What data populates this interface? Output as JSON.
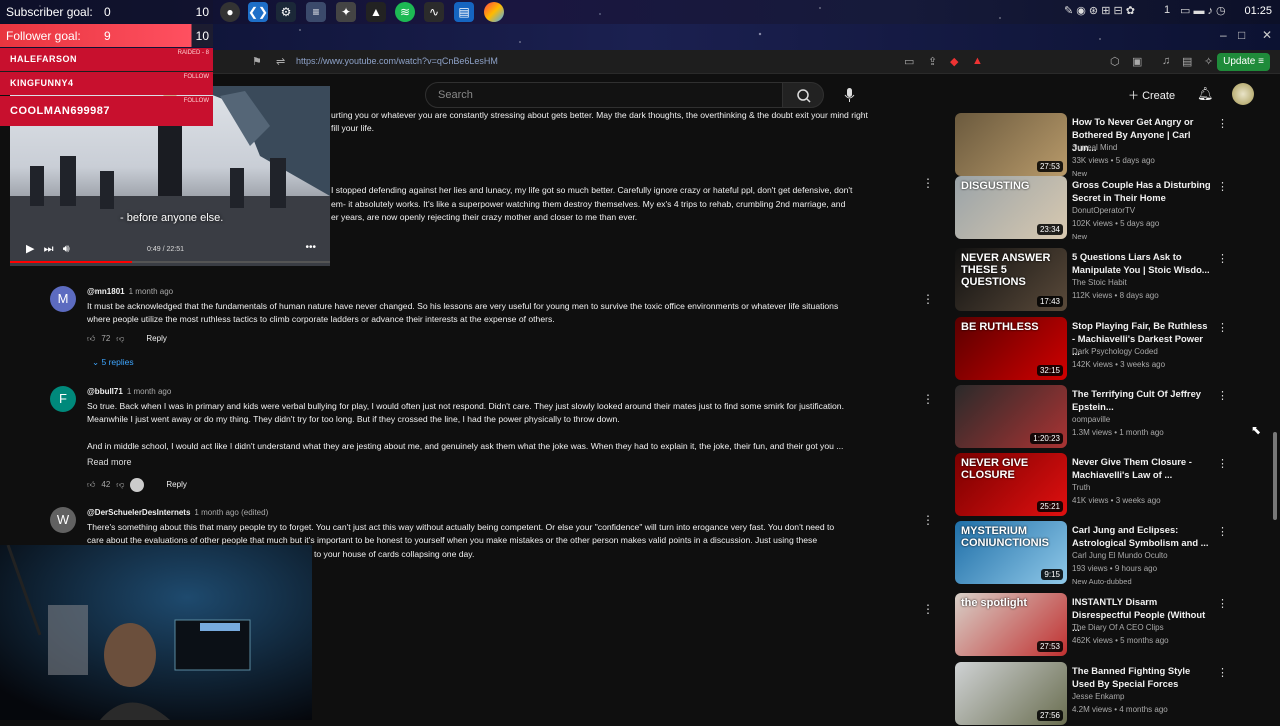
{
  "taskbar": {
    "clock": "01:25",
    "tray_number": "1"
  },
  "stream": {
    "subscriber_goal": {
      "label": "Subscriber goal:",
      "current": "0",
      "target": "10"
    },
    "follower_goal": {
      "label": "Follower goal:",
      "current": "9",
      "target": "10"
    },
    "alerts": [
      {
        "name": "HALEFARSON",
        "tag": "RAIDED - 8"
      },
      {
        "name": "KINGFUNNY4",
        "tag": "FOLLOW"
      },
      {
        "name": "COOLMAN699987",
        "tag": "FOLLOW"
      }
    ],
    "video": {
      "caption": "- before anyone else.",
      "time": "0:49 / 22:51",
      "progress": 0.04
    }
  },
  "browser": {
    "url": "https://www.youtube.com/watch?v=qCnBe6LesHM",
    "update_label": "Update"
  },
  "masthead": {
    "search_placeholder": "Search",
    "create_label": "Create"
  },
  "comments": {
    "partial1": "urting you or whatever you are constantly stressing about gets better. May the dark thoughts, the overthinking & the doubt exit your mind right",
    "partial1b": "fill your life.",
    "partial2a": "I stopped defending against her lies and lunacy, my life got so much better.  Carefully ignore crazy or hateful ppl, don't get defensive, don't",
    "partial2b": "em- it absolutely works.  It's like a superpower watching them destroy themselves. My ex's 4 trips to rehab, crumbling 2nd marriage, and",
    "partial2c": "er years, are now openly rejecting their crazy mother and closer to me than ever.",
    "items": [
      {
        "avatar": "M",
        "handle": "@mn1801",
        "time": "1 month ago",
        "lines": [
          "It must be acknowledged that the fundamentals of human nature have never changed. So his lessons are very useful for young men to survive the toxic office environments or whatever life situations",
          "where people utilize the most ruthless tactics to climb corporate ladders or advance their interests at the expense of others."
        ],
        "likes": "72",
        "reply": "Reply",
        "replies": "5 replies"
      },
      {
        "avatar": "F",
        "handle": "@bbull71",
        "time": "1 month ago",
        "lines": [
          "So true. Back when I was in primary and kids were verbal bullying for play, I would often just not respond. Didn't care. They just slowly looked around their mates just to find some smirk for justification.",
          "Meanwhile I just went away or do my thing. They didn't try for too long. But if they crossed the line, I had the power physically to throw down.",
          "",
          "And in middle school, I would act like I didn't understand what they are jesting about me, and genuinely ask them what the joke was. When they had to explain it, the joke, their fun, and their got you ..."
        ],
        "read_more": "Read more",
        "likes": "42",
        "reply": "Reply"
      },
      {
        "avatar": "W",
        "handle": "@DerSchuelerDesInternets",
        "time": "1 month ago (edited)",
        "lines": [
          "There's something about this that many people try to forget. You can't just act this way without actually being competent. Or else your \"confidence\" will turn into erogance very fast. You don't need to",
          "care about the evaluations of other people that much but it's important to be honest to yourself when you make mistakes or the other person makes valid points in a discussion. Just using these",
          "to your house of cards collapsing one day."
        ]
      }
    ]
  },
  "sidebar": [
    {
      "title": "How To Never Get Angry or Bothered By Anyone | Carl Jun...",
      "channel": "Surreal Mind",
      "meta": "33K views • 5 days ago",
      "badge": "New",
      "duration": "27:53",
      "thumb_text": "",
      "colors": [
        "#6b5a3e",
        "#b89a6a"
      ]
    },
    {
      "title": "Gross Couple Has a Disturbing Secret in Their Home",
      "channel": "DonutOperatorTV",
      "meta": "102K views • 5 days ago",
      "badge": "New",
      "duration": "23:34",
      "thumb_text": "DISGUSTING",
      "colors": [
        "#9aa3a8",
        "#d8c9b0"
      ]
    },
    {
      "title": "5 Questions Liars Ask to Manipulate You | Stoic Wisdo...",
      "channel": "The Stoic Habit",
      "meta": "112K views • 8 days ago",
      "badge": "",
      "duration": "17:43",
      "thumb_text": "NEVER ANSWER THESE 5 QUESTIONS",
      "colors": [
        "#111",
        "#5a4a3a"
      ]
    },
    {
      "title": "Stop Playing Fair, Be Ruthless - Machiavelli's Darkest Power ...",
      "channel": "Dark Psychology Coded",
      "meta": "142K views • 3 weeks ago",
      "badge": "",
      "duration": "32:15",
      "thumb_text": "BE RUTHLESS",
      "colors": [
        "#5a0000",
        "#d00000"
      ]
    },
    {
      "title": "The Terrifying Cult Of Jeffrey Epstein...",
      "channel": "oompaville",
      "meta": "1.3M views • 1 month ago",
      "badge": "",
      "duration": "1:20:23",
      "thumb_text": "",
      "colors": [
        "#2a2a2a",
        "#aa3333"
      ]
    },
    {
      "title": "Never Give Them Closure - Machiavelli's Law of ...",
      "channel": "Truth",
      "meta": "41K views • 3 weeks ago",
      "badge": "",
      "duration": "25:21",
      "thumb_text": "NEVER GIVE CLOSURE",
      "colors": [
        "#7a0000",
        "#e01010"
      ]
    },
    {
      "title": "Carl Jung and Eclipses: Astrological Symbolism and ...",
      "channel": "Carl Jung El Mundo Oculto",
      "meta": "193 views • 9 hours ago",
      "badge": "New   Auto-dubbed",
      "duration": "9:15",
      "thumb_text": "MYSTERIUM CONIUNCTIONIS",
      "colors": [
        "#1f6fa8",
        "#8fc8e8"
      ]
    },
    {
      "title": "INSTANTLY Disarm Disrespectful People (Without ...",
      "channel": "The Diary Of A CEO Clips",
      "meta": "462K views • 5 months ago",
      "badge": "",
      "duration": "27:53",
      "thumb_text": "the spotlight",
      "colors": [
        "#d8d0c8",
        "#c03030"
      ]
    },
    {
      "title": "The Banned Fighting Style Used By Special Forces",
      "channel": "Jesse Enkamp",
      "meta": "4.2M views • 4 months ago",
      "badge": "",
      "duration": "27:56",
      "thumb_text": "",
      "colors": [
        "#cfd2d4",
        "#6a6e50"
      ]
    }
  ]
}
